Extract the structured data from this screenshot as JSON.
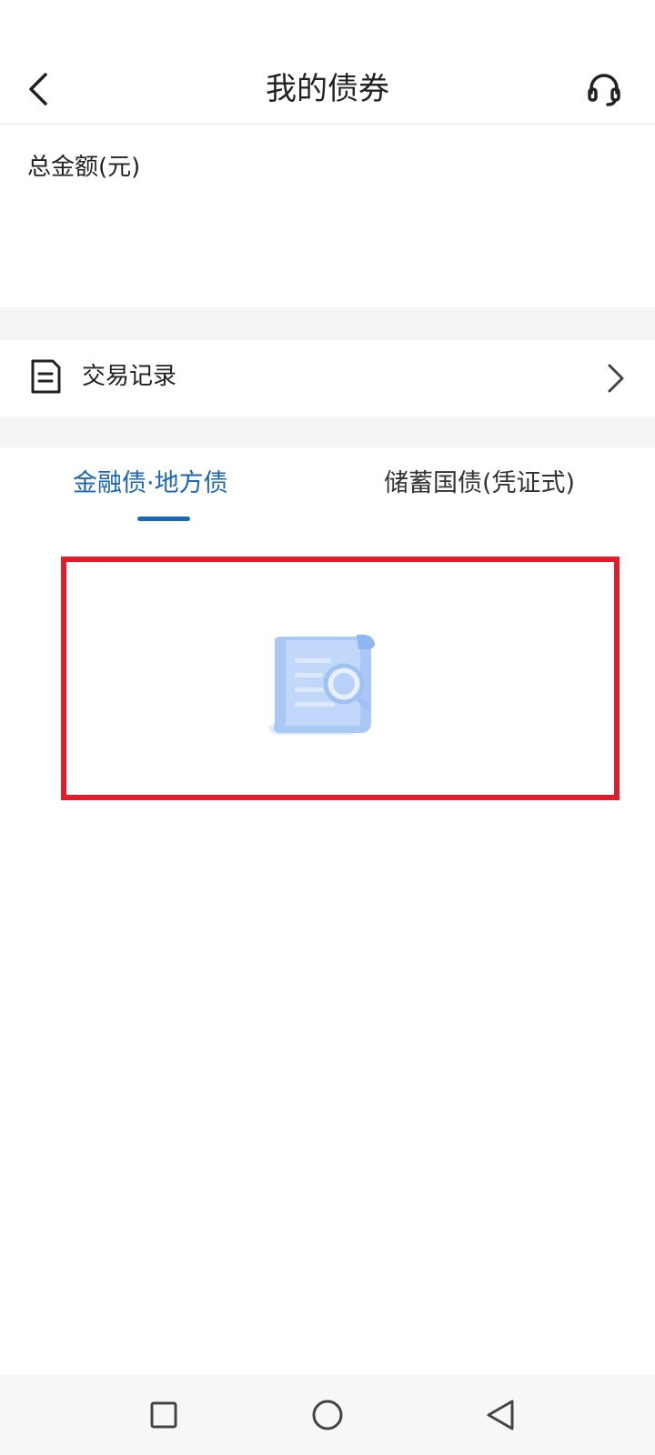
{
  "header": {
    "title": "我的债券",
    "back_icon": "chevron-left-icon",
    "service_icon": "headset-icon"
  },
  "summary": {
    "total_label": "总金额(元)"
  },
  "transactions": {
    "label": "交易记录",
    "icon": "document-icon",
    "chevron_icon": "chevron-right-icon"
  },
  "tabs": [
    {
      "label": "金融债·地方债",
      "active": true
    },
    {
      "label": "储蓄国债(凭证式)",
      "active": false
    }
  ],
  "empty_state": {
    "icon": "document-search-illustration"
  },
  "navbar": {
    "recent_icon": "square-icon",
    "home_icon": "circle-icon",
    "back_icon": "triangle-back-icon"
  },
  "colors": {
    "accent": "#1a66b7",
    "highlight": "#e01e2b",
    "divider": "#f4f4f4"
  }
}
